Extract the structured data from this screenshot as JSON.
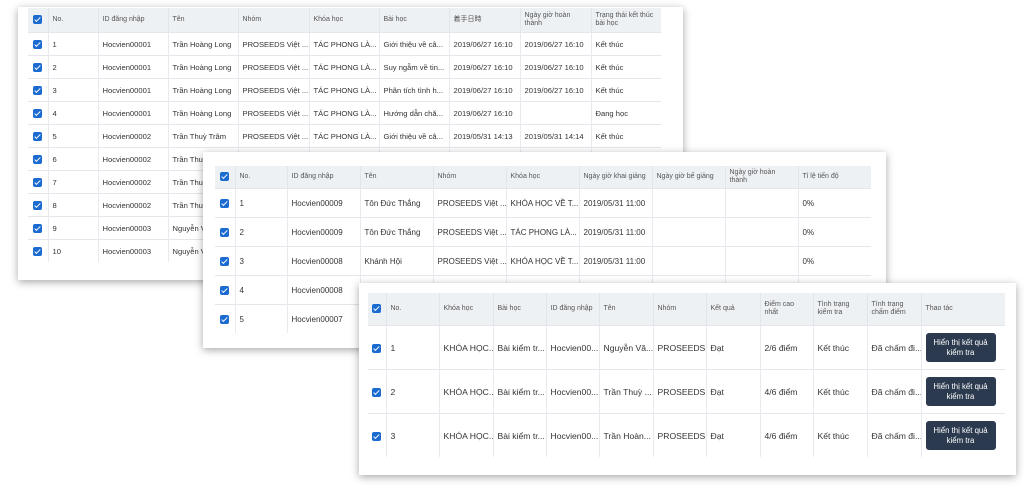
{
  "card1": {
    "headers": [
      "No.",
      "ID đăng nhập",
      "Tên",
      "Nhóm",
      "Khóa học",
      "Bài học",
      "着手日時",
      "Ngày giờ hoàn thành",
      "Trạng thái kết thúc bài học"
    ],
    "rows": [
      [
        "1",
        "Hocvien00001",
        "Trần Hoàng Long",
        "PROSEEDS Việt ...",
        "TÁC PHONG LÀ...",
        "Giới thiệu về câ...",
        "2019/06/27 16:10",
        "2019/06/27 16:10",
        "Kết thúc"
      ],
      [
        "2",
        "Hocvien00001",
        "Trần Hoàng Long",
        "PROSEEDS Việt ...",
        "TÁC PHONG LÀ...",
        "Suy ngẫm về tin...",
        "2019/06/27 16:10",
        "2019/06/27 16:10",
        "Kết thúc"
      ],
      [
        "3",
        "Hocvien00001",
        "Trần Hoàng Long",
        "PROSEEDS Việt ...",
        "TÁC PHONG LÀ...",
        "Phân tích tình h...",
        "2019/06/27 16:10",
        "2019/06/27 16:10",
        "Kết thúc"
      ],
      [
        "4",
        "Hocvien00001",
        "Trần Hoàng Long",
        "PROSEEDS Việt ...",
        "TÁC PHONG LÀ...",
        "Hướng dẫn chă...",
        "2019/06/27 16:10",
        "",
        "Đang học"
      ],
      [
        "5",
        "Hocvien00002",
        "Trần Thuỳ Trâm",
        "PROSEEDS Việt ...",
        "TÁC PHONG LÀ...",
        "Giới thiệu về câ...",
        "2019/05/31 14:13",
        "2019/05/31 14:14",
        "Kết thúc"
      ],
      [
        "6",
        "Hocvien00002",
        "Trần Thuỳ",
        "",
        "",
        "",
        "",
        "",
        ""
      ],
      [
        "7",
        "Hocvien00002",
        "Trần Thuỳ",
        "",
        "",
        "",
        "",
        "",
        ""
      ],
      [
        "8",
        "Hocvien00002",
        "Trần Thuỳ",
        "",
        "",
        "",
        "",
        "",
        ""
      ],
      [
        "9",
        "Hocvien00003",
        "Nguyễn V",
        "",
        "",
        "",
        "",
        "",
        ""
      ],
      [
        "10",
        "Hocvien00003",
        "Nguyễn V",
        "",
        "",
        "",
        "",
        "",
        ""
      ]
    ]
  },
  "card2": {
    "headers": [
      "No.",
      "ID đăng nhập",
      "Tên",
      "Nhóm",
      "Khóa học",
      "Ngày giờ khai giảng",
      "Ngày giờ bế giảng",
      "Ngày giờ hoàn thành",
      "Tỉ lệ tiến độ"
    ],
    "rows": [
      [
        "1",
        "Hocvien00009",
        "Tôn Đức Thắng",
        "PROSEEDS Việt ...",
        "KHÓA HỌC VỀ T...",
        "2019/05/31 11:00",
        "",
        "",
        "0%"
      ],
      [
        "2",
        "Hocvien00009",
        "Tôn Đức Thắng",
        "PROSEEDS Việt ...",
        "TÁC PHONG LÀ...",
        "2019/05/31 11:00",
        "",
        "",
        "0%"
      ],
      [
        "3",
        "Hocvien00008",
        "Khánh Hội",
        "PROSEEDS Việt ...",
        "KHÓA HỌC VỀ T...",
        "2019/05/31 11:00",
        "",
        "",
        "0%"
      ],
      [
        "4",
        "Hocvien00008",
        "",
        "",
        "",
        "",
        "",
        "",
        ""
      ],
      [
        "5",
        "Hocvien00007",
        "",
        "",
        "",
        "",
        "",
        "",
        ""
      ]
    ]
  },
  "card3": {
    "headers": [
      "No.",
      "Khóa học",
      "Bài học",
      "ID đăng nhập",
      "Tên",
      "Nhóm",
      "Kết quả",
      "Điểm cao nhất",
      "Tình trạng kiểm tra",
      "Tình trạng chấm điểm",
      "Thao tác"
    ],
    "rows": [
      [
        "1",
        "KHÓA HỌC...",
        "Bài kiểm tr...",
        "Hocvien00...",
        "Nguyễn Vă...",
        "PROSEEDS ...",
        "Đạt",
        "2/6 điểm",
        "Kết thúc",
        "Đã chấm đi..."
      ],
      [
        "2",
        "KHÓA HỌC...",
        "Bài kiểm tr...",
        "Hocvien00...",
        "Trần Thuỳ ...",
        "PROSEEDS ...",
        "Đạt",
        "4/6 điểm",
        "Kết thúc",
        "Đã chấm đi..."
      ],
      [
        "3",
        "KHÓA HỌC...",
        "Bài kiểm tr...",
        "Hocvien00...",
        "Trần Hoàn...",
        "PROSEEDS ...",
        "Đạt",
        "4/6 điểm",
        "Kết thúc",
        "Đã chấm đi..."
      ]
    ],
    "action_label": "Hiển thị kết quả kiểm tra"
  },
  "colors": {
    "checkbox": "#1b6bd0",
    "header_bg": "#eef1f4",
    "button_bg": "#2b3a4e"
  }
}
